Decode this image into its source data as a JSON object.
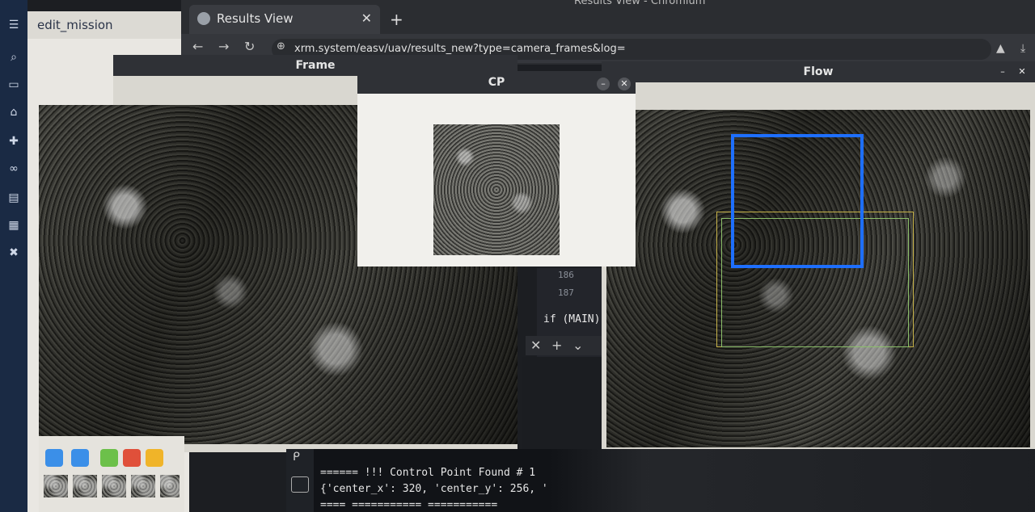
{
  "browser": {
    "tab_title": "Results View",
    "window_title": "Results View - Chromium",
    "url": "xrm.system/easv/uav/results_new?type=camera_frames&log="
  },
  "edit_panel": {
    "tab_title": "edit_mission"
  },
  "windows": {
    "frame_title": "Frame",
    "flow_title": "Flow",
    "cp_title": "CP"
  },
  "code": {
    "line_numbers": [
      "186",
      "187"
    ],
    "snippet": "if (MAIN)[\"ve"
  },
  "terminal": {
    "lines": [
      "====== !!! Control Point Found # 1",
      "{'center_x': 320, 'center_y': 256, '",
      "====  ===========  ==========="
    ]
  },
  "toolbar": {
    "colors": [
      "#3b8fe8",
      "#3b8fe8",
      "#6cc04a",
      "#e0503a",
      "#f0b429"
    ]
  },
  "icons": {
    "sidebar": [
      "menu-icon",
      "search-icon",
      "folder-icon",
      "home-icon",
      "puzzle-icon",
      "link-icon",
      "document-icon",
      "calendar-icon",
      "settings-icon"
    ]
  }
}
